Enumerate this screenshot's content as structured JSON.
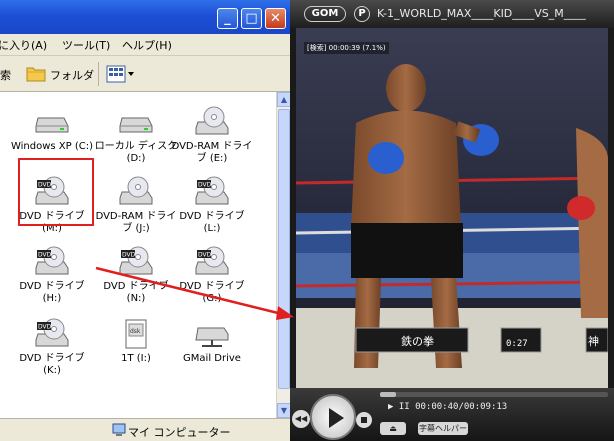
{
  "explorer": {
    "menu": {
      "favorites": "に入り(A)",
      "tools": "ツール(T)",
      "help": "ヘルプ(H)"
    },
    "toolbar": {
      "search": "索",
      "folders": "フォルダ"
    },
    "drives": [
      {
        "icon": "hard-drive-icon",
        "label": "Windows XP (C:)"
      },
      {
        "icon": "hard-drive-icon",
        "label": "ローカル ディスク (D:)"
      },
      {
        "icon": "dvd-ram-drive-icon",
        "label": "DVD-RAM ドライブ (E:)"
      },
      {
        "icon": "dvd-drive-icon",
        "label": "DVD ドライブ (M:)"
      },
      {
        "icon": "dvd-ram-drive-icon",
        "label": "DVD-RAM ドライブ (J:)"
      },
      {
        "icon": "dvd-drive-icon",
        "label": "DVD ドライブ (L:)"
      },
      {
        "icon": "dvd-drive-icon",
        "label": "DVD ドライブ (H:)"
      },
      {
        "icon": "dvd-drive-icon",
        "label": "DVD ドライブ (N:)"
      },
      {
        "icon": "dvd-drive-icon",
        "label": "DVD ドライブ (G:)"
      },
      {
        "icon": "dvd-drive-icon",
        "label": "DVD ドライブ (K:)"
      },
      {
        "icon": "disk-image-icon",
        "label": "1T (I:)"
      },
      {
        "icon": "network-drive-icon",
        "label": "GMail Drive"
      }
    ],
    "status": {
      "text": "マイ コンピューター"
    }
  },
  "player": {
    "logo": "GOM",
    "p_button": "P",
    "title": "K-1_WORLD_MAX____KID____VS_M____",
    "osd": "[検索] 00:00:39 (7.1%)",
    "time": "▶ II 00:00:40/00:09:13",
    "seek_progress": 0.07,
    "subtitle_button": "字幕ヘルパー",
    "eject_button": "⏏"
  },
  "colors": {
    "selection": "#e02020",
    "xp_titlebar": "#1c4fd6"
  }
}
